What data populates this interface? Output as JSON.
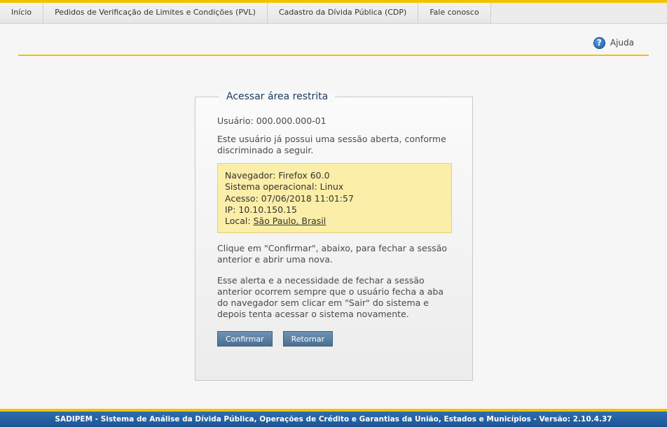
{
  "nav": {
    "items": [
      {
        "label": "Início"
      },
      {
        "label": "Pedidos de Verificação de Limites e Condições (PVL)"
      },
      {
        "label": "Cadastro da Dívida Pública (CDP)"
      },
      {
        "label": "Fale conosco"
      }
    ]
  },
  "help": {
    "label": "Ajuda",
    "icon": "question-circle-icon"
  },
  "panel": {
    "title": "Acessar área restrita",
    "user_line": "Usuário: 000.000.000-01",
    "intro": "Este usuário já possui uma sessão aberta, conforme discriminado a seguir.",
    "session": {
      "browser": "Navegador: Firefox 60.0",
      "os": "Sistema operacional: Linux",
      "access": "Acesso: 07/06/2018 11:01:57",
      "ip": "IP: 10.10.150.15",
      "location_label": "Local: ",
      "location_link": "São Paulo, Brasil"
    },
    "confirm_text": "Clique em \"Confirmar\", abaixo, para fechar a sessão anterior e abrir uma nova.",
    "note": "Esse alerta e a necessidade de fechar a sessão anterior ocorrem sempre que o usuário fecha a aba do navegador sem clicar em \"Sair\" do sistema e depois tenta acessar o sistema novamente.",
    "confirm_button": "Confirmar",
    "return_button": "Retornar"
  },
  "footer": {
    "text": "SADIPEM - Sistema de Análise da Dívida Pública, Operações de Crédito e Garantias da União, Estados e Municípios - Versão: 2.10.4.37"
  },
  "colors": {
    "accent": "#f2c200",
    "footer": "#1d5595",
    "info_box": "#fbeea8",
    "button": "#4a6f93"
  }
}
